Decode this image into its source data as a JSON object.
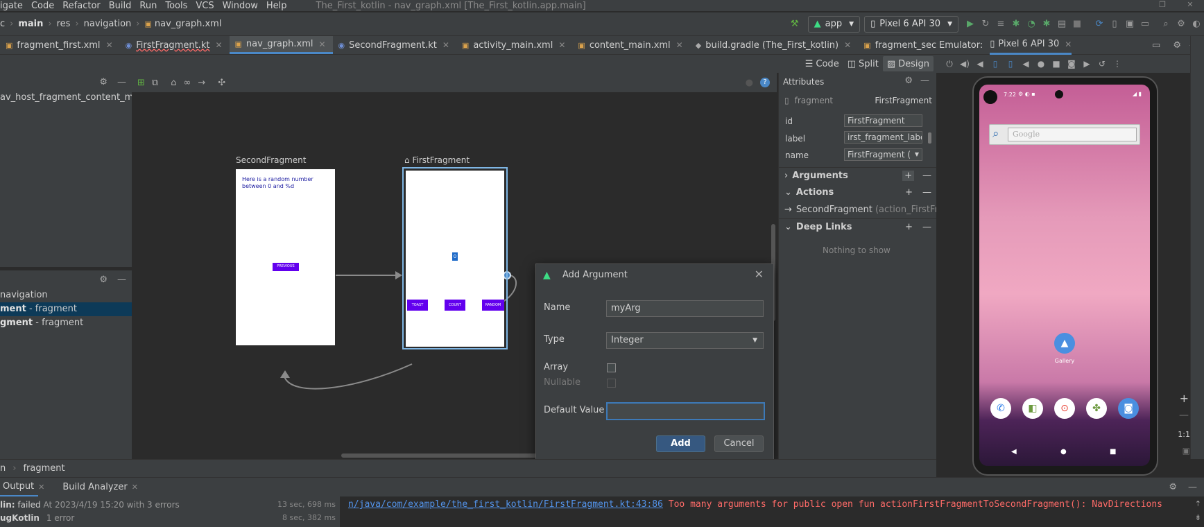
{
  "menubar": {
    "items": [
      "igate",
      "Code",
      "Refactor",
      "Build",
      "Run",
      "Tools",
      "VCS",
      "Window",
      "Help"
    ],
    "window_title": "The_First_kotlin - nav_graph.xml [The_First_kotlin.app.main]"
  },
  "navbar": {
    "crumbs": [
      "c",
      "main",
      "res",
      "navigation",
      "nav_graph.xml"
    ],
    "run_config": "app",
    "device": "Pixel 6 API 30"
  },
  "tabs": [
    {
      "label": "fragment_first.xml",
      "icon": "xml-file-icon"
    },
    {
      "label": "FirstFragment.kt",
      "icon": "kotlin-file-icon"
    },
    {
      "label": "nav_graph.xml",
      "icon": "xml-file-icon",
      "active": true
    },
    {
      "label": "SecondFragment.kt",
      "icon": "kotlin-file-icon"
    },
    {
      "label": "activity_main.xml",
      "icon": "xml-file-icon"
    },
    {
      "label": "content_main.xml",
      "icon": "xml-file-icon"
    },
    {
      "label": "build.gradle (The_First_kotlin)",
      "icon": "gradle-icon"
    },
    {
      "label": "fragment_second.xml",
      "icon": "xml-file-icon"
    }
  ],
  "emulator_header": {
    "label": "Emulator:",
    "device_tab": "Pixel 6 API 30"
  },
  "design_modes": {
    "code": "Code",
    "split": "Split",
    "design": "Design"
  },
  "left_top": {
    "host": "av_host_fragment_content_main)"
  },
  "left_bottom": {
    "items": [
      {
        "bold": "",
        "rest": "navigation"
      },
      {
        "bold": "ment",
        "rest": " - fragment"
      },
      {
        "bold": "gment",
        "rest": " - fragment"
      }
    ]
  },
  "canvas": {
    "second_label": "SecondFragment",
    "second_text": "Here is a random number between 0 and %d",
    "second_button": "PREVIOUS",
    "first_label": "FirstFragment",
    "first_center": "0",
    "first_buttons": [
      "TOAST",
      "COUNT",
      "RANDOM"
    ]
  },
  "dialog": {
    "title": "Add Argument",
    "name_label": "Name",
    "name_value": "myArg",
    "type_label": "Type",
    "type_value": "Integer",
    "array_label": "Array",
    "nullable_label": "Nullable",
    "default_label": "Default Value",
    "default_value": "",
    "add": "Add",
    "cancel": "Cancel"
  },
  "attributes": {
    "title": "Attributes",
    "kind": "fragment",
    "kind_value": "FirstFragment",
    "id_label": "id",
    "id_value": "FirstFragment",
    "label_label": "label",
    "label_value": "irst_fragment_label",
    "name_label": "name",
    "name_value": "FirstFragment (",
    "arguments": "Arguments",
    "actions": "Actions",
    "action_dest": "SecondFragment",
    "action_id": "(action_FirstFrag",
    "deep_links": "Deep Links",
    "empty": "Nothing to show"
  },
  "phone": {
    "time": "7:22",
    "search_placeholder": "Google",
    "gallery": "Gallery",
    "zoom": "1:1"
  },
  "breadcrumb": {
    "a": "n",
    "b": "fragment"
  },
  "build": {
    "tabs": [
      "Output",
      "Build Analyzer"
    ],
    "row1_label": "lin:",
    "row1_status": "failed",
    "row1_detail": "At 2023/4/19 15:20 with 3 errors",
    "row1_time": "13 sec, 698 ms",
    "row2_label": "ugKotlin",
    "row2_detail": "1 error",
    "row2_time": "8 sec, 382 ms",
    "error_link": "n/java/com/example/the_first_kotlin/FirstFragment.kt:43:86",
    "error_msg": "Too many arguments for public open fun actionFirstFragmentToSecondFragment(): NavDirections"
  },
  "colors": {
    "accent": "#4a88c7",
    "primary": "#365880",
    "android_purple": "#6200ee",
    "error": "#ff6b68"
  }
}
